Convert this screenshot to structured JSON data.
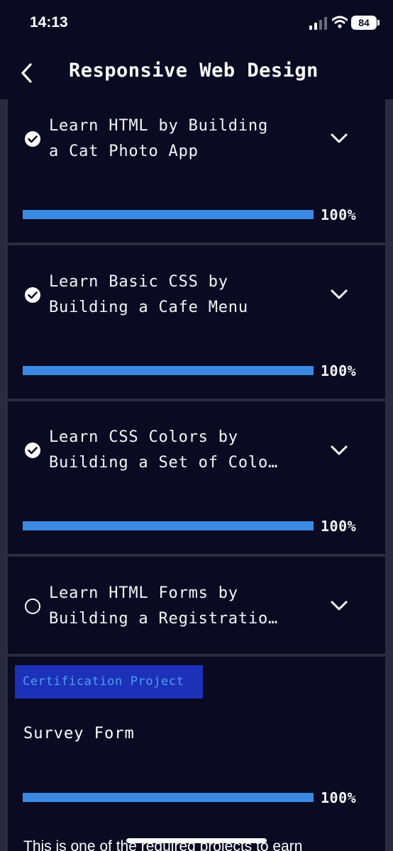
{
  "status_bar": {
    "time": "14:13",
    "battery": "84"
  },
  "header": {
    "title": "Responsive Web Design",
    "back_icon": "chevron-left-icon"
  },
  "courses": [
    {
      "title_line1": "Learn HTML by Building",
      "title_line2": "a Cat Photo App",
      "completed": true,
      "progress": 100,
      "progress_label": "100%"
    },
    {
      "title_line1": "Learn Basic CSS by",
      "title_line2": "Building a Cafe Menu",
      "completed": true,
      "progress": 100,
      "progress_label": "100%"
    },
    {
      "title_line1": "Learn CSS Colors by",
      "title_line2": "Building a Set of Colo…",
      "completed": true,
      "progress": 100,
      "progress_label": "100%"
    },
    {
      "title_line1": "Learn HTML Forms by",
      "title_line2": "Building a Registratio…",
      "completed": false
    }
  ],
  "certification": {
    "badge": "Certification Project",
    "project_title": "Survey Form",
    "progress": 100,
    "progress_label": "100%",
    "description": "This is one of the required projects to earn"
  },
  "colors": {
    "background": "#0a0a23",
    "divider": "#2a2a40",
    "progress_fill": "#3b89e0",
    "badge_bg": "#1d30b8",
    "badge_text": "#4d9ff0"
  }
}
